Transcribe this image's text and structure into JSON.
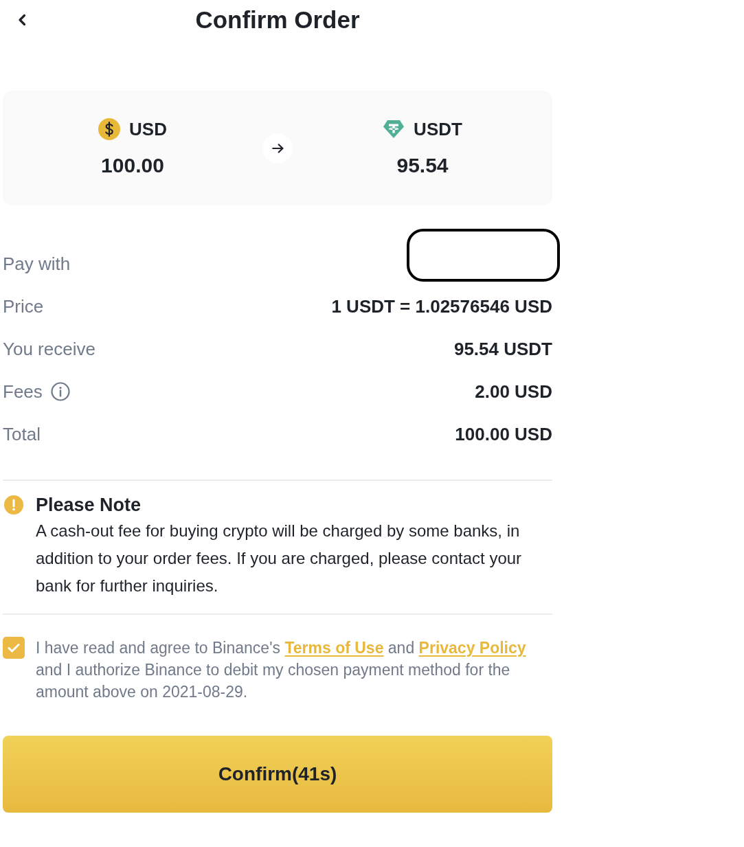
{
  "header": {
    "title": "Confirm Order"
  },
  "conversion": {
    "from": {
      "kind": "usd",
      "currency": "USD",
      "amount": "100.00"
    },
    "to": {
      "kind": "usdt",
      "currency": "USDT",
      "amount": "95.54"
    }
  },
  "details": [
    {
      "label": "Pay with",
      "info": false,
      "redacted": true
    },
    {
      "label": "Price",
      "info": false,
      "redacted": false,
      "value": "1 USDT = 1.02576546 USD"
    },
    {
      "label": "You receive",
      "info": false,
      "redacted": false,
      "value": "95.54 USDT"
    },
    {
      "label": "Fees",
      "info": true,
      "redacted": false,
      "value": "2.00 USD"
    },
    {
      "label": "Total",
      "info": false,
      "redacted": false,
      "value": "100.00 USD"
    }
  ],
  "note": {
    "title": "Please Note",
    "text": "A cash-out fee for buying crypto will be charged by some banks, in addition to your order fees. If you are charged, please contact your bank for further inquiries."
  },
  "agreement": {
    "checked": true,
    "parts": [
      {
        "kind": "text",
        "text": "I have read and agree to Binance's "
      },
      {
        "kind": "link",
        "text": "Terms of Use"
      },
      {
        "kind": "text",
        "text": " and "
      },
      {
        "kind": "link",
        "text": "Privacy Policy"
      },
      {
        "kind": "text",
        "text": " and I authorize Binance to debit my chosen payment method for the amount above on 2021-08-29."
      }
    ]
  },
  "confirm_button": {
    "label": "Confirm(41s)"
  }
}
